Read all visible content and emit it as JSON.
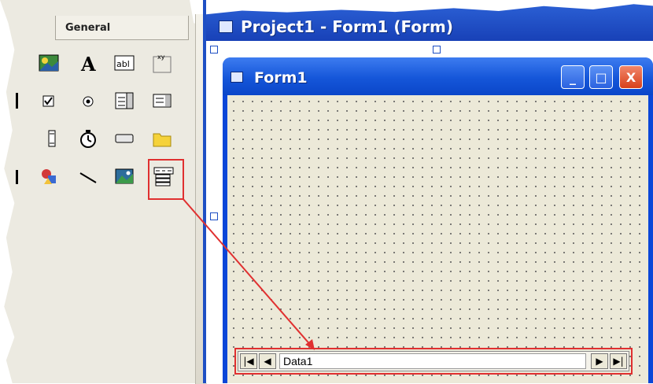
{
  "toolbox": {
    "tab_label": "General"
  },
  "project_window": {
    "title": "Project1 - Form1 (Form)"
  },
  "form": {
    "title": "Form1",
    "controls": {
      "minimize": "_",
      "maximize": "□",
      "close": "X"
    }
  },
  "data_control": {
    "caption": "Data1",
    "first": "|◀",
    "prev": "◀",
    "next": "▶",
    "last": "▶|"
  },
  "colors": {
    "titlebar": "#1e4fc4",
    "highlight": "#e03030",
    "close_button": "#d8411b"
  }
}
